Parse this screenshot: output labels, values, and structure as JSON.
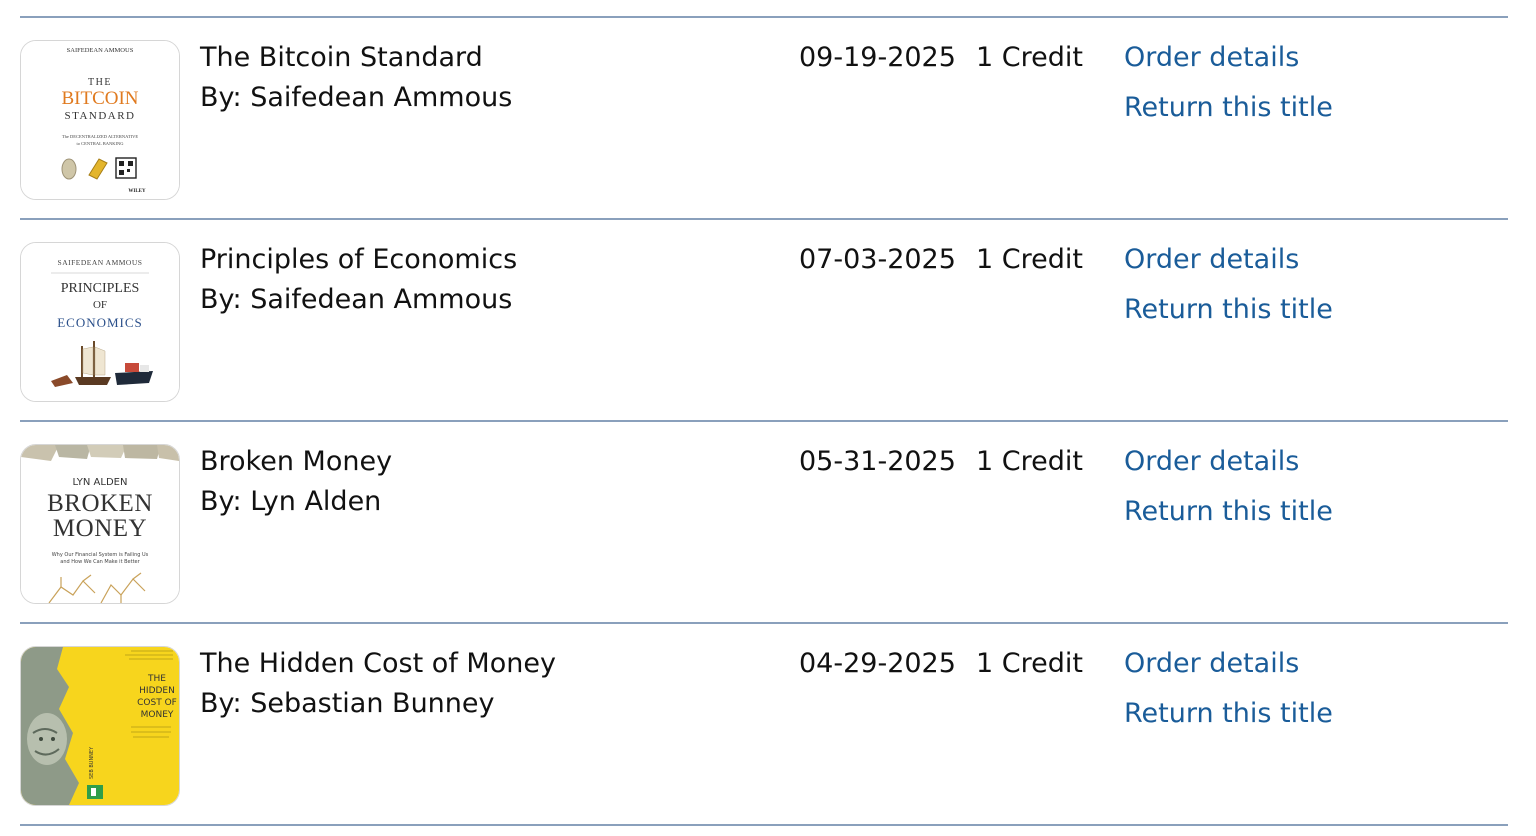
{
  "orders": [
    {
      "title": "The Bitcoin Standard",
      "author": "By: Saifedean Ammous",
      "date": "09-19-2025",
      "credit": "1 Credit",
      "order_details": "Order details",
      "return_title": "Return this title",
      "cover": {
        "author_line": "SAIFEDEAN AMMOUS",
        "line1": "THE",
        "line2": "BITCOIN",
        "line3": "STANDARD",
        "sub1": "The DECENTRALIZED ALTERNATIVE",
        "sub2": "to CENTRAL BANKING",
        "publisher": "WILEY",
        "accent": "#e07a1f"
      }
    },
    {
      "title": "Principles of Economics",
      "author": "By: Saifedean Ammous",
      "date": "07-03-2025",
      "credit": "1 Credit",
      "order_details": "Order details",
      "return_title": "Return this title",
      "cover": {
        "author_line": "SAIFEDEAN AMMOUS",
        "line1": "PRINCIPLES",
        "line2": "OF",
        "line3": "ECONOMICS",
        "accent": "#2a4f8a"
      }
    },
    {
      "title": "Broken Money",
      "author": "By: Lyn Alden",
      "date": "05-31-2025",
      "credit": "1 Credit",
      "order_details": "Order details",
      "return_title": "Return this title",
      "cover": {
        "author_line": "LYN ALDEN",
        "line1": "BROKEN",
        "line2": "MONEY",
        "sub1": "Why Our Financial System is Failing Us",
        "sub2": "and How We Can Make it Better",
        "accent": "#c9a25a"
      }
    },
    {
      "title": "The Hidden Cost of Money",
      "author": "By: Sebastian Bunney",
      "date": "04-29-2025",
      "credit": "1 Credit",
      "order_details": "Order details",
      "return_title": "Return this title",
      "cover": {
        "line1": "THE",
        "line2": "HIDDEN",
        "line3": "COST OF",
        "line4": "MONEY",
        "spine": "SEB BUNNEY",
        "accent": "#f7d51d"
      }
    }
  ]
}
